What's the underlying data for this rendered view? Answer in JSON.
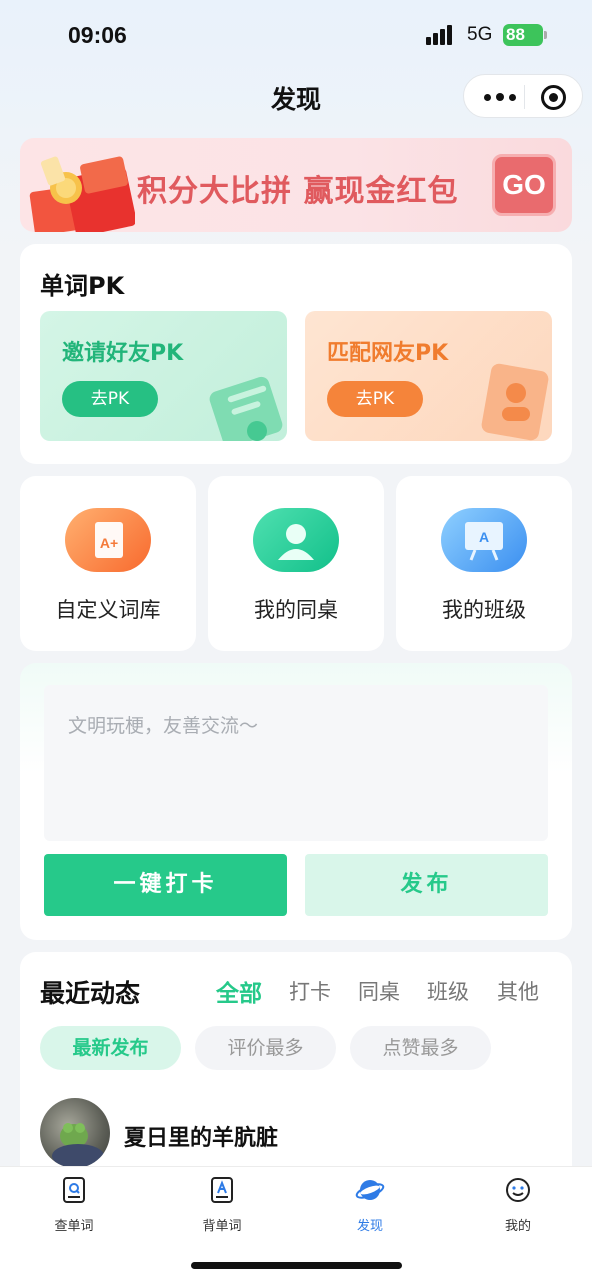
{
  "status_bar": {
    "time": "09:06",
    "network": "5G",
    "battery": "88"
  },
  "nav": {
    "title": "发现"
  },
  "banner": {
    "text": "积分大比拼  赢现金红包",
    "button": "GO"
  },
  "pk": {
    "title": "单词PK",
    "invite": {
      "label": "邀请好友PK",
      "button": "去PK"
    },
    "match": {
      "label": "匹配网友PK",
      "button": "去PK"
    }
  },
  "features": [
    {
      "label": "自定义词库",
      "glyph": "A+"
    },
    {
      "label": "我的同桌"
    },
    {
      "label": "我的班级",
      "glyph": "A"
    }
  ],
  "post": {
    "placeholder": "文明玩梗，友善交流～",
    "checkin_button": "一键打卡",
    "publish_button": "发布"
  },
  "recent": {
    "title": "最近动态",
    "tabs": [
      "全部",
      "打卡",
      "同桌",
      "班级",
      "其他"
    ],
    "sorts": [
      "最新发布",
      "评价最多",
      "点赞最多"
    ],
    "first_user": "夏日里的羊肮脏"
  },
  "tabbar": [
    {
      "label": "查单词",
      "icon": "search-book-icon"
    },
    {
      "label": "背单词",
      "icon": "memorize-book-icon"
    },
    {
      "label": "发现",
      "icon": "planet-icon"
    },
    {
      "label": "我的",
      "icon": "face-icon"
    }
  ],
  "colors": {
    "accent": "#26c98a",
    "tab_active": "#2e7be6",
    "banner_text": "#e05a5e",
    "orange": "#f5843a"
  }
}
